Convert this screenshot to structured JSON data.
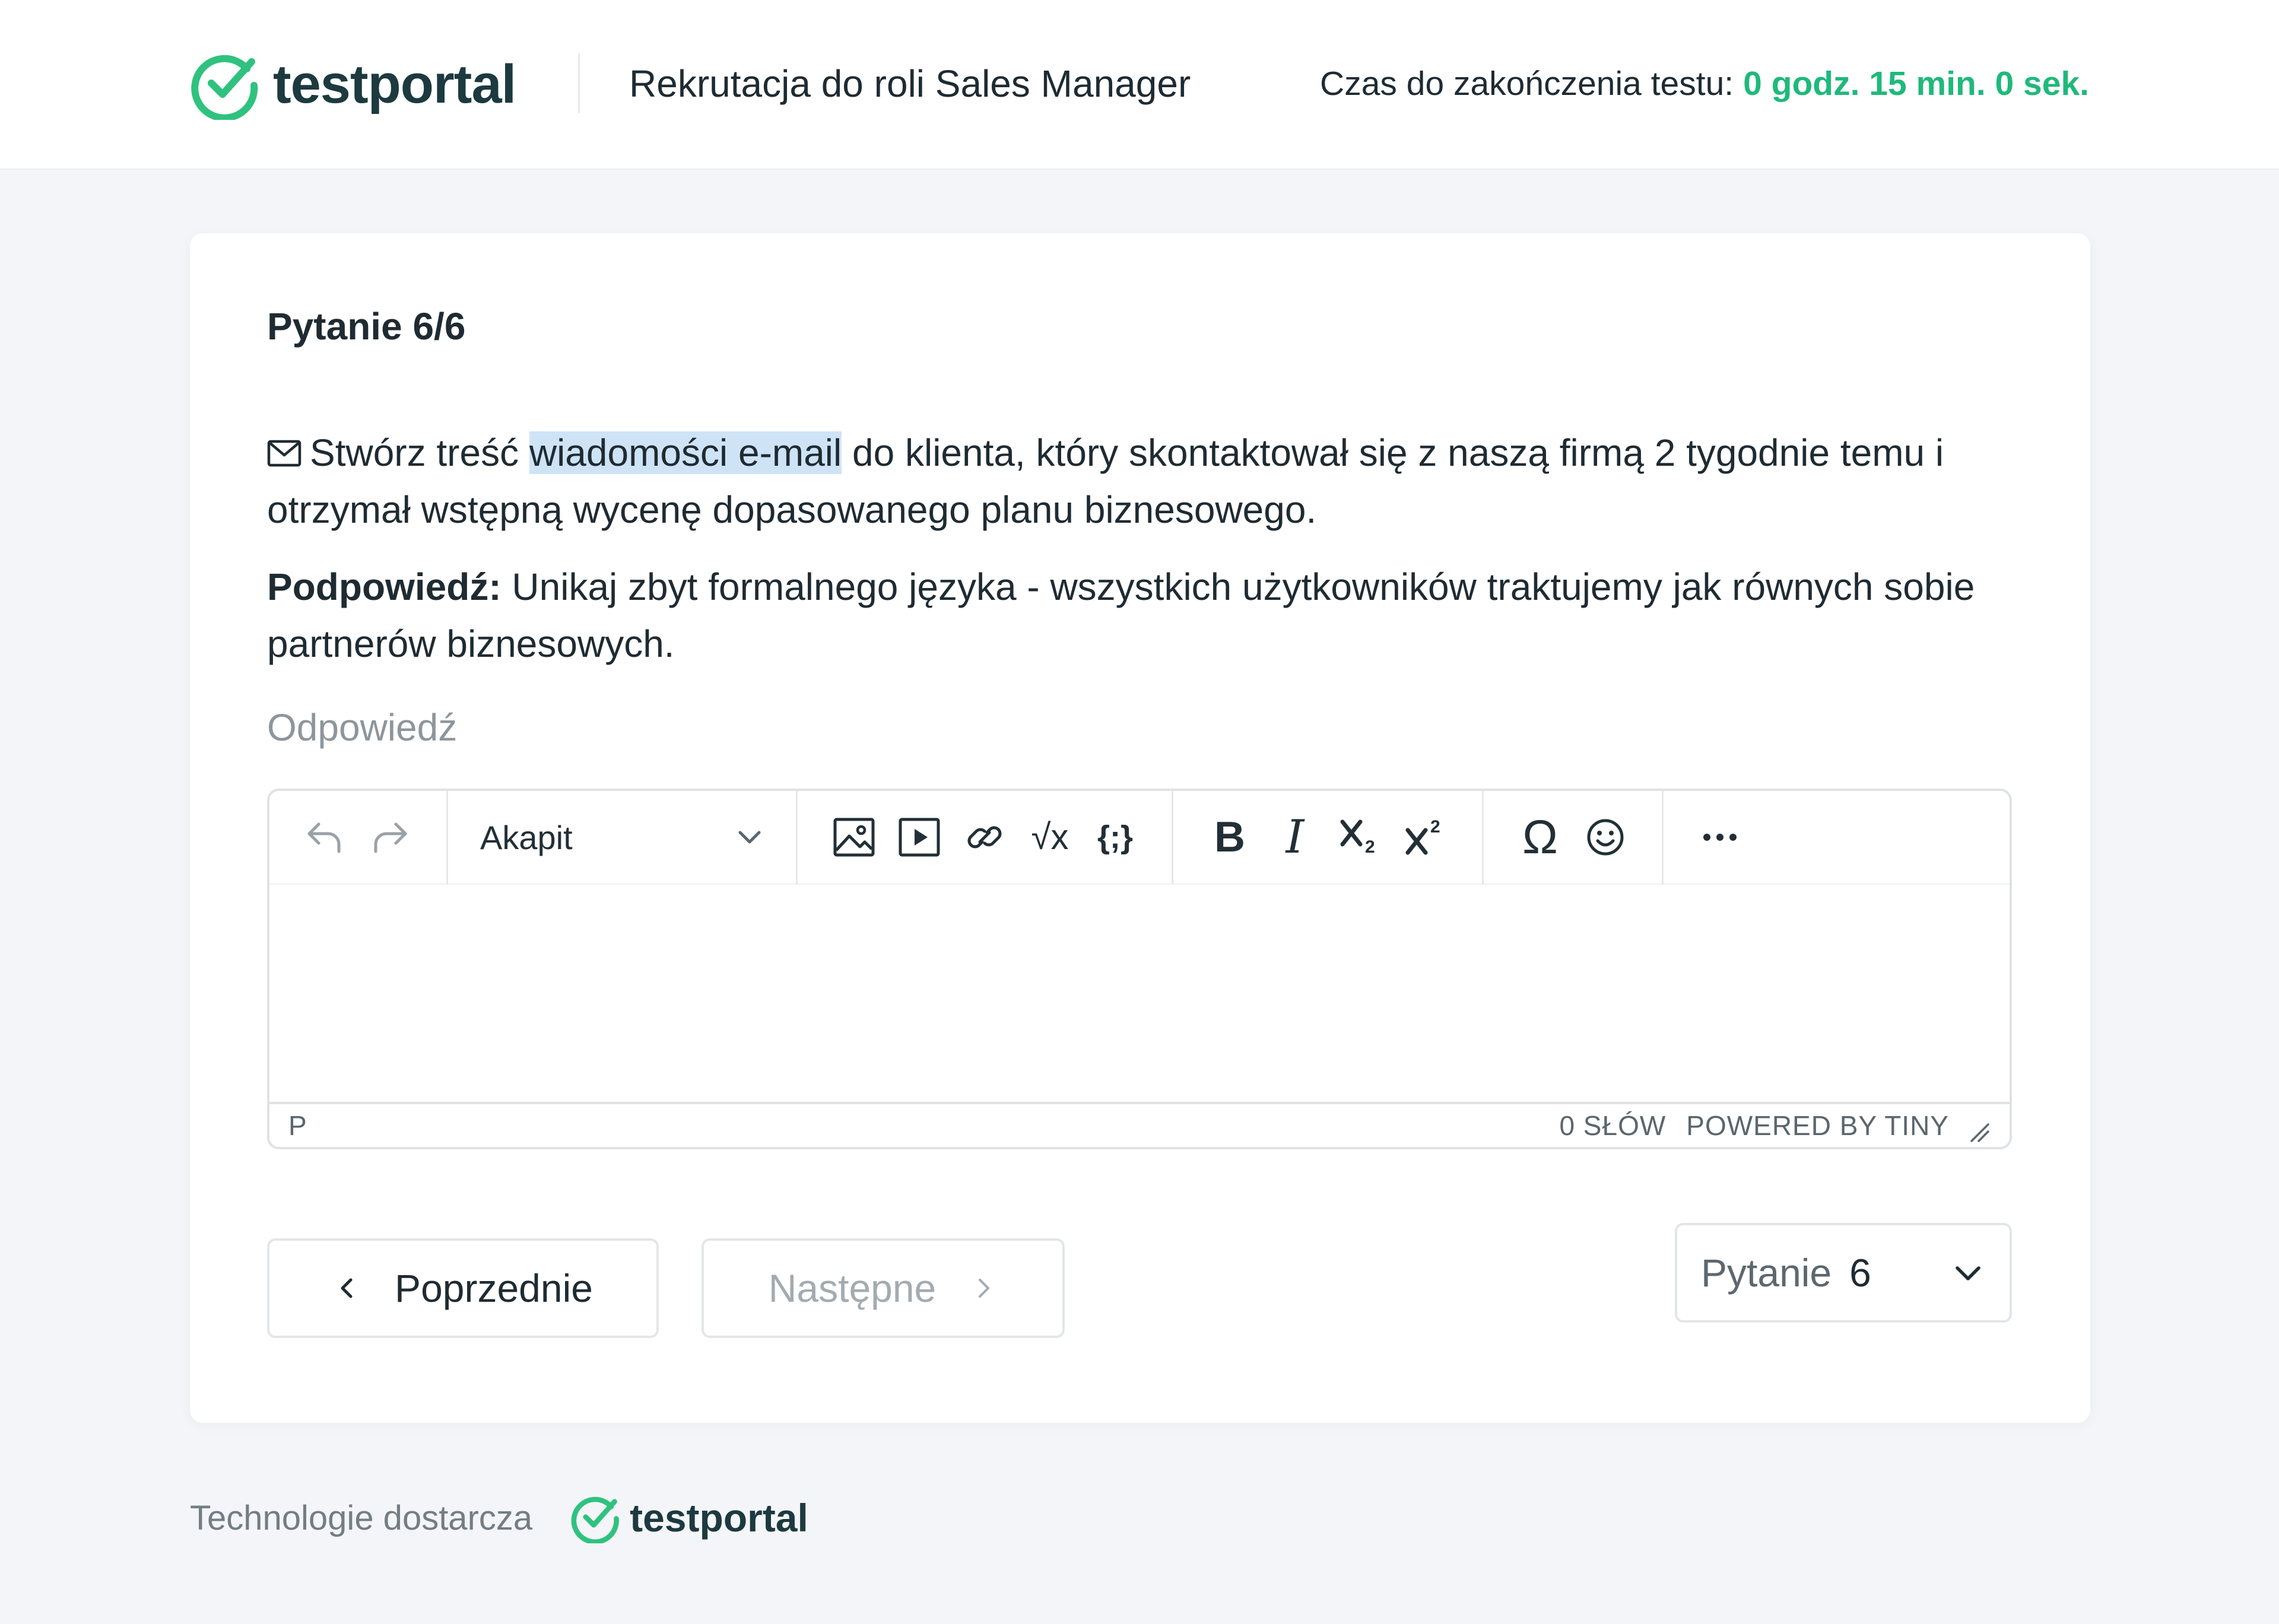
{
  "header": {
    "logo_text": "testportal",
    "test_title": "Rekrutacja do roli Sales Manager",
    "timer_label": "Czas do zakończenia testu:",
    "timer_value": "0 godz. 15 min. 0 sek."
  },
  "question": {
    "number": "Pytanie 6/6",
    "text_before": "Stwórz treść ",
    "text_highlight": "wiadomości e-mail",
    "text_after": " do klienta, który skontaktował się z naszą firmą 2 tygodnie temu i otrzymał wstępną wycenę dopasowanego planu biznesowego.",
    "hint_label": "Podpowiedź:",
    "hint_text": " Unikaj zbyt formalnego języka - wszystkich użytkowników traktujemy jak równych sobie partnerów biznesowych."
  },
  "answer": {
    "label": "Odpowiedź"
  },
  "editor": {
    "block_format": "Akapit",
    "status_path": "P",
    "word_count": "0 SŁÓW",
    "powered_by": "POWERED BY TINY",
    "tools": {
      "bold": "B",
      "italic": "I",
      "omega": "Ω",
      "math": "√x",
      "code": "{;}"
    }
  },
  "navigation": {
    "prev_label": "Poprzednie",
    "next_label": "Następne",
    "question_select_label": "Pytanie",
    "question_select_value": "6"
  },
  "footer": {
    "provided_by": "Technologie dostarcza",
    "logo_text": "testportal"
  },
  "colors": {
    "accent": "#1fb97b",
    "dark": "#1c3a3f",
    "highlight": "#cfe3f7"
  }
}
